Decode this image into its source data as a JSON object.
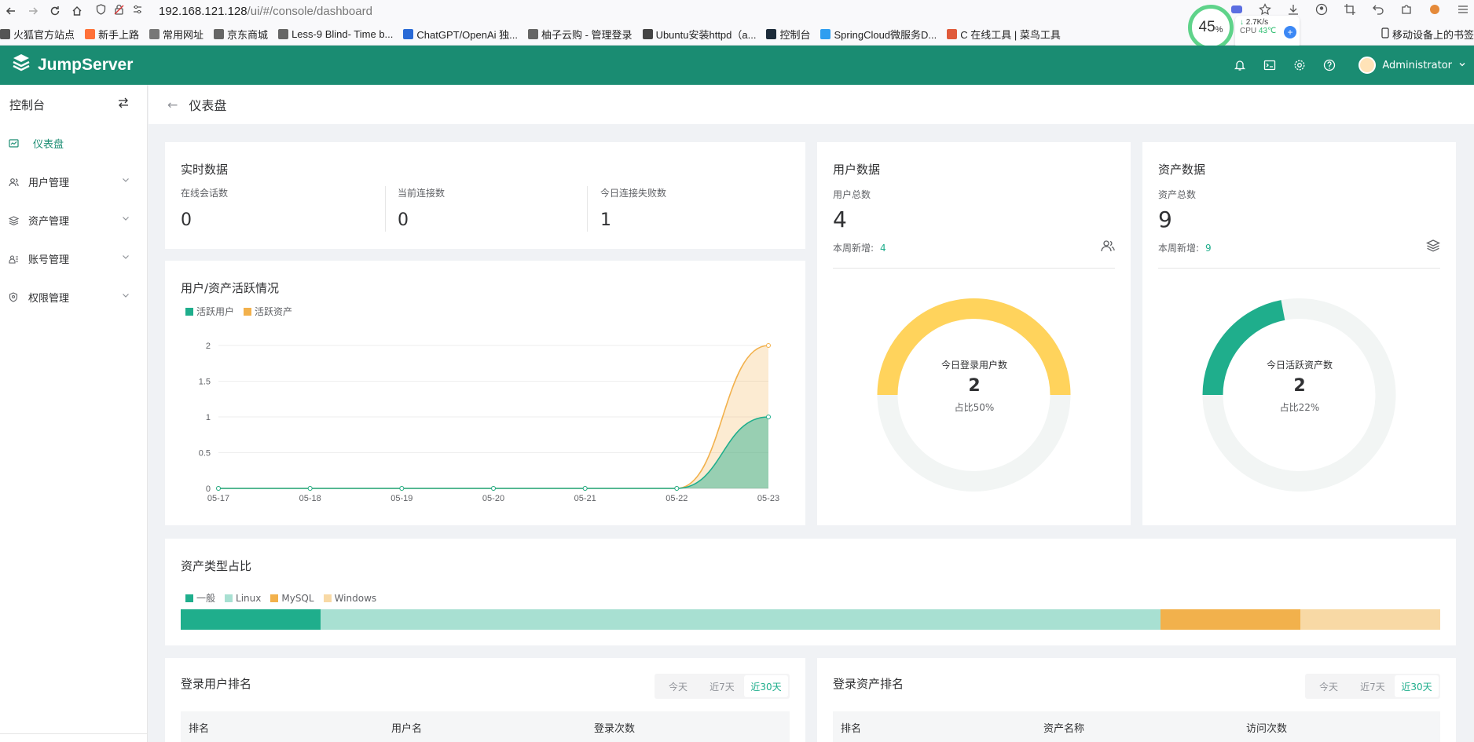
{
  "browser": {
    "url_host": "192.168.121.128",
    "url_path": "/ui/#/console/dashboard",
    "bookmarks": [
      {
        "label": "火狐官方站点",
        "color": "#555555"
      },
      {
        "label": "新手上路",
        "color": "#ff7139"
      },
      {
        "label": "常用网址",
        "color": "#777777"
      },
      {
        "label": "京东商城",
        "color": "#666666"
      },
      {
        "label": "Less-9 Blind- Time b...",
        "color": "#666666"
      },
      {
        "label": "ChatGPT/OpenAi 独...",
        "color": "#2a6ad6"
      },
      {
        "label": "柚子云购 - 管理登录",
        "color": "#666666"
      },
      {
        "label": "Ubuntu安装httpd（a...",
        "color": "#444444"
      },
      {
        "label": "控制台",
        "color": "#1c2b3a"
      },
      {
        "label": "SpringCloud微服务D...",
        "color": "#2f9ef0"
      },
      {
        "label": "C 在线工具 | 菜鸟工具",
        "color": "#e05a3a"
      }
    ],
    "bookmark_right": "移动设备上的书签",
    "cpu_percent": "45",
    "cpu_percent_unit": "%",
    "net_speed": "2.7K/s",
    "cpu_label": "CPU",
    "cpu_temp": "43℃"
  },
  "app": {
    "brand": "JumpServer",
    "user_name": "Administrator",
    "accent": "#1a8c72"
  },
  "sidebar": {
    "title": "控制台",
    "items": [
      {
        "label": "仪表盘",
        "icon": "dashboard-icon",
        "active": true
      },
      {
        "label": "用户管理",
        "icon": "users-icon"
      },
      {
        "label": "资产管理",
        "icon": "assets-icon"
      },
      {
        "label": "账号管理",
        "icon": "accounts-icon"
      },
      {
        "label": "权限管理",
        "icon": "permissions-icon"
      }
    ]
  },
  "page": {
    "title": "仪表盘"
  },
  "realtime": {
    "title": "实时数据",
    "items": [
      {
        "label": "在线会话数",
        "value": "0"
      },
      {
        "label": "当前连接数",
        "value": "0"
      },
      {
        "label": "今日连接失败数",
        "value": "1"
      }
    ]
  },
  "activity": {
    "title": "用户/资产活跃情况"
  },
  "user_data": {
    "title": "用户数据",
    "total_label": "用户总数",
    "total": "4",
    "week_label": "本周新增:",
    "week_value": "4",
    "donut_title": "今日登录用户数",
    "donut_value": "2",
    "donut_percent": "占比50%",
    "fraction": 0.5,
    "color": "#ffd35c"
  },
  "asset_data": {
    "title": "资产数据",
    "total_label": "资产总数",
    "total": "9",
    "week_label": "本周新增:",
    "week_value": "9",
    "donut_title": "今日活跃资产数",
    "donut_value": "2",
    "donut_percent": "占比22%",
    "fraction": 0.22,
    "color": "#1fae8c"
  },
  "asset_types": {
    "title": "资产类型占比"
  },
  "rank_user": {
    "title": "登录用户排名",
    "tabs": [
      "今天",
      "近7天",
      "近30天"
    ],
    "active_tab": "近30天",
    "columns": [
      "排名",
      "用户名",
      "登录次数"
    ]
  },
  "rank_asset": {
    "title": "登录资产排名",
    "tabs": [
      "今天",
      "近7天",
      "近30天"
    ],
    "active_tab": "近30天",
    "columns": [
      "排名",
      "资产名称",
      "访问次数"
    ]
  },
  "chart_data": [
    {
      "type": "area",
      "categories": [
        "05-17",
        "05-18",
        "05-19",
        "05-20",
        "05-21",
        "05-22",
        "05-23"
      ],
      "series": [
        {
          "name": "活跃用户",
          "values": [
            0,
            0,
            0,
            0,
            0,
            0,
            1
          ],
          "color": "#1fae8c"
        },
        {
          "name": "活跃资产",
          "values": [
            0,
            0,
            0,
            0,
            0,
            0,
            2
          ],
          "color": "#f2b14c"
        }
      ],
      "ylim": [
        0,
        2
      ],
      "yticks": [
        "0",
        "0.5",
        "1",
        "1.5",
        "2"
      ],
      "legend": "top-left"
    },
    {
      "type": "bar",
      "stacked": true,
      "categories": [
        "一般",
        "Linux",
        "MySQL",
        "Windows"
      ],
      "values": [
        1,
        6,
        1,
        1
      ],
      "colors": [
        "#1fae8c",
        "#a8e0d2",
        "#f2b14c",
        "#f8d9a5"
      ],
      "legend": "top-left"
    }
  ]
}
